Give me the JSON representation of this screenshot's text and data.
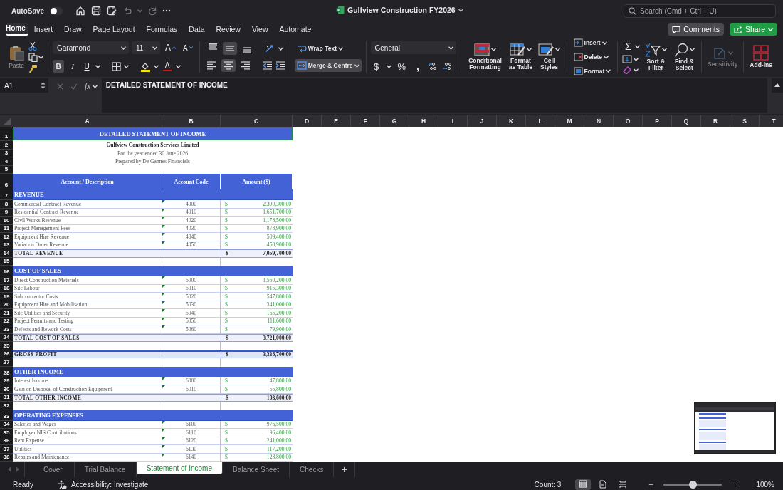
{
  "title_bar": {
    "autosave": {
      "label": "AutoSave",
      "on": false
    },
    "document_title": "Gulfview Construction FY2026",
    "search": {
      "placeholder": "Search (Cmd + Ctrl + U)"
    }
  },
  "ribbon_tabs": [
    {
      "label": "Home",
      "selected": true
    },
    {
      "label": "Insert",
      "selected": false
    },
    {
      "label": "Draw",
      "selected": false
    },
    {
      "label": "Page Layout",
      "selected": false
    },
    {
      "label": "Formulas",
      "selected": false
    },
    {
      "label": "Data",
      "selected": false
    },
    {
      "label": "Review",
      "selected": false
    },
    {
      "label": "View",
      "selected": false
    },
    {
      "label": "Automate",
      "selected": false
    }
  ],
  "comments_button": "Comments",
  "share_button": "Share",
  "ribbon": {
    "paste": "Paste",
    "font_name": "Garamond",
    "font_size": "11",
    "grow_font": "A",
    "shrink_font": "A",
    "text_style": [
      {
        "kind": "bold",
        "label": "B",
        "on": true
      },
      {
        "kind": "italic",
        "label": "I",
        "on": false
      },
      {
        "kind": "underline",
        "label": "U",
        "on": false
      }
    ],
    "font_color": "A",
    "vertical_align": [
      {
        "kind": "top",
        "selected": false
      },
      {
        "kind": "middle",
        "selected": true
      },
      {
        "kind": "bottom",
        "selected": false
      }
    ],
    "horizontal_align": [
      {
        "kind": "left",
        "selected": false
      },
      {
        "kind": "center",
        "selected": true
      },
      {
        "kind": "right",
        "selected": false
      }
    ],
    "wrap_text": {
      "label": "Wrap Text",
      "on": false
    },
    "merge_centre": {
      "label": "Merge & Centre",
      "on": true
    },
    "number_format": "General",
    "currency": "$",
    "percent": "%",
    "comma": ",",
    "conditional_formatting": "Conditional Formatting",
    "format_as_table": "Format as Table",
    "cell_styles": "Cell Styles",
    "insert": "Insert",
    "delete": "Delete",
    "format": "Format",
    "autosum": "Σ",
    "sort_filter": "Sort & Filter",
    "find_select": "Find & Select",
    "sensitivity": {
      "label": "Sensitivity",
      "disabled": true
    },
    "add_ins": "Add-ins"
  },
  "formula_bar": {
    "name_box": "A1",
    "fx": "fx",
    "formula": "DETAILED STATEMENT OF INCOME"
  },
  "columns": [
    "A",
    "B",
    "C",
    "D",
    "E",
    "F",
    "G",
    "H",
    "I",
    "J",
    "K",
    "L",
    "M",
    "N",
    "O",
    "P",
    "Q",
    "R",
    "S",
    "T"
  ],
  "rows": [
    {
      "n": "1",
      "kind": "title",
      "a": "DETAILED STATEMENT OF INCOME",
      "selected": true
    },
    {
      "n": "2",
      "kind": "company",
      "a": "Gulfview Construction Services Limited"
    },
    {
      "n": "3",
      "kind": "subtitle",
      "a": "For the year ended 30 June 2026"
    },
    {
      "n": "4",
      "kind": "subtitle",
      "a": "Prepared by De Gannes Financials"
    },
    {
      "n": "5",
      "kind": "blank"
    },
    {
      "n": "6",
      "kind": "header",
      "a": "Account / Description",
      "b": "Account Code",
      "c": "Amount ($)"
    },
    {
      "n": "7",
      "kind": "section",
      "a": "REVENUE"
    },
    {
      "n": "8",
      "kind": "item",
      "a": "Commercial Contract Revenue",
      "b": "4000",
      "cur": "$",
      "c": "2,390,300.00"
    },
    {
      "n": "9",
      "kind": "item",
      "a": "Residential Contract Revenue",
      "b": "4010",
      "cur": "$",
      "c": "1,651,700.00"
    },
    {
      "n": "10",
      "kind": "item",
      "a": "Civil Works Revenue",
      "b": "4020",
      "cur": "$",
      "c": "1,178,500.00"
    },
    {
      "n": "11",
      "kind": "item",
      "a": "Project Management Fees",
      "b": "4030",
      "cur": "$",
      "c": "878,900.00"
    },
    {
      "n": "12",
      "kind": "item",
      "a": "Equipment Hire Revenue",
      "b": "4040",
      "cur": "$",
      "c": "509,400.00"
    },
    {
      "n": "13",
      "kind": "item",
      "a": "Variation Order Revenue",
      "b": "4050",
      "cur": "$",
      "c": "450,900.00"
    },
    {
      "n": "14",
      "kind": "total",
      "a": "TOTAL REVENUE",
      "cur": "$",
      "c": "7,059,700.00"
    },
    {
      "n": "15",
      "kind": "gap"
    },
    {
      "n": "16",
      "kind": "section",
      "a": "COST OF SALES"
    },
    {
      "n": "17",
      "kind": "item",
      "a": "Direct Construction Materials",
      "b": "5000",
      "cur": "$",
      "c": "1,560,200.00"
    },
    {
      "n": "18",
      "kind": "item",
      "a": "Site Labour",
      "b": "5010",
      "cur": "$",
      "c": "915,300.00"
    },
    {
      "n": "19",
      "kind": "item",
      "a": "Subcontractor Costs",
      "b": "5020",
      "cur": "$",
      "c": "547,800.00"
    },
    {
      "n": "20",
      "kind": "item",
      "a": "Equipment Hire and Mobilisation",
      "b": "5030",
      "cur": "$",
      "c": "341,000.00"
    },
    {
      "n": "21",
      "kind": "item",
      "a": "Site Utilities and Security",
      "b": "5040",
      "cur": "$",
      "c": "165,200.00"
    },
    {
      "n": "22",
      "kind": "item",
      "a": "Project Permits and Testing",
      "b": "5050",
      "cur": "$",
      "c": "111,600.00"
    },
    {
      "n": "23",
      "kind": "item",
      "a": "Defects and Rework Costs",
      "b": "5060",
      "cur": "$",
      "c": "79,900.00"
    },
    {
      "n": "24",
      "kind": "total",
      "a": "TOTAL COST OF SALES",
      "cur": "$",
      "c": "3,721,000.00"
    },
    {
      "n": "25",
      "kind": "gap"
    },
    {
      "n": "26",
      "kind": "profit",
      "a": "GROSS PROFIT",
      "cur": "$",
      "c": "3,338,700.00"
    },
    {
      "n": "27",
      "kind": "gap"
    },
    {
      "n": "28",
      "kind": "section",
      "a": "OTHER INCOME"
    },
    {
      "n": "29",
      "kind": "item",
      "a": "Interest Income",
      "b": "6000",
      "cur": "$",
      "c": "47,800.00"
    },
    {
      "n": "30",
      "kind": "item",
      "a": "Gain on Disposal of Construction Equipment",
      "b": "6010",
      "cur": "$",
      "c": "55,800.00"
    },
    {
      "n": "31",
      "kind": "total",
      "a": "TOTAL OTHER INCOME",
      "cur": "$",
      "c": "103,600.00"
    },
    {
      "n": "32",
      "kind": "gap"
    },
    {
      "n": "33",
      "kind": "section",
      "a": "OPERATING EXPENSES"
    },
    {
      "n": "34",
      "kind": "item",
      "a": "Salaries and Wages",
      "b": "6100",
      "cur": "$",
      "c": "976,500.00"
    },
    {
      "n": "35",
      "kind": "item",
      "a": "Employer NIS Contributions",
      "b": "6110",
      "cur": "$",
      "c": "96,400.00"
    },
    {
      "n": "36",
      "kind": "item",
      "a": "Rent Expense",
      "b": "6120",
      "cur": "$",
      "c": "241,000.00"
    },
    {
      "n": "37",
      "kind": "item",
      "a": "Utilities",
      "b": "6130",
      "cur": "$",
      "c": "117,200.00"
    },
    {
      "n": "38",
      "kind": "item",
      "a": "Repairs and Maintenance",
      "b": "6140",
      "cur": "$",
      "c": "128,800.00"
    }
  ],
  "sheet_tabs": [
    {
      "label": "Cover",
      "selected": false
    },
    {
      "label": "Trial Balance",
      "selected": false
    },
    {
      "label": "Statement of Income",
      "selected": true
    },
    {
      "label": "Balance Sheet",
      "selected": false
    },
    {
      "label": "Checks",
      "selected": false
    }
  ],
  "add_sheet": "+",
  "status_bar": {
    "ready": "Ready",
    "accessibility": "Accessibility: Investigate",
    "count": "Count: 3",
    "view_modes": [
      {
        "kind": "normal",
        "selected": true
      },
      {
        "kind": "page_layout",
        "selected": false
      },
      {
        "kind": "page_break",
        "selected": false
      }
    ],
    "zoom": {
      "minus": "−",
      "plus": "+",
      "level": 0.5,
      "reading": "100%"
    }
  }
}
